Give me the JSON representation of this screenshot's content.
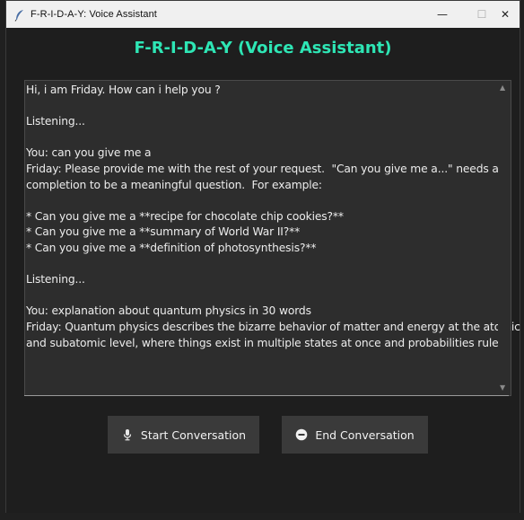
{
  "window": {
    "title": "F-R-I-D-A-Y: Voice Assistant",
    "minimize_glyph": "—",
    "maximize_glyph": "☐",
    "close_glyph": "✕"
  },
  "app": {
    "heading": "F-R-I-D-A-Y (Voice Assistant)"
  },
  "conversation": {
    "lines": [
      "Hi, i am Friday. How can i help you ?",
      "",
      "Listening...",
      "",
      "You: can you give me a",
      "Friday: Please provide me with the rest of your request.  \"Can you give me a...\" needs a",
      "completion to be a meaningful question.  For example:",
      "",
      "* Can you give me a **recipe for chocolate chip cookies?**",
      "* Can you give me a **summary of World War II?**",
      "* Can you give me a **definition of photosynthesis?**",
      "",
      "Listening...",
      "",
      "You: explanation about quantum physics in 30 words",
      "Friday: Quantum physics describes the bizarre behavior of matter and energy at the atomic",
      "and subatomic level, where things exist in multiple states at once and probabilities rule."
    ]
  },
  "buttons": {
    "start_label": "Start Conversation",
    "end_label": "End Conversation"
  },
  "colors": {
    "heading": "#2ee6b5",
    "background": "#1e1e1e",
    "textbox": "#2d2d2d",
    "button": "#3a3a3a"
  },
  "icons": {
    "app": "feather-icon",
    "start": "microphone-icon",
    "end": "stop-circle-icon"
  }
}
